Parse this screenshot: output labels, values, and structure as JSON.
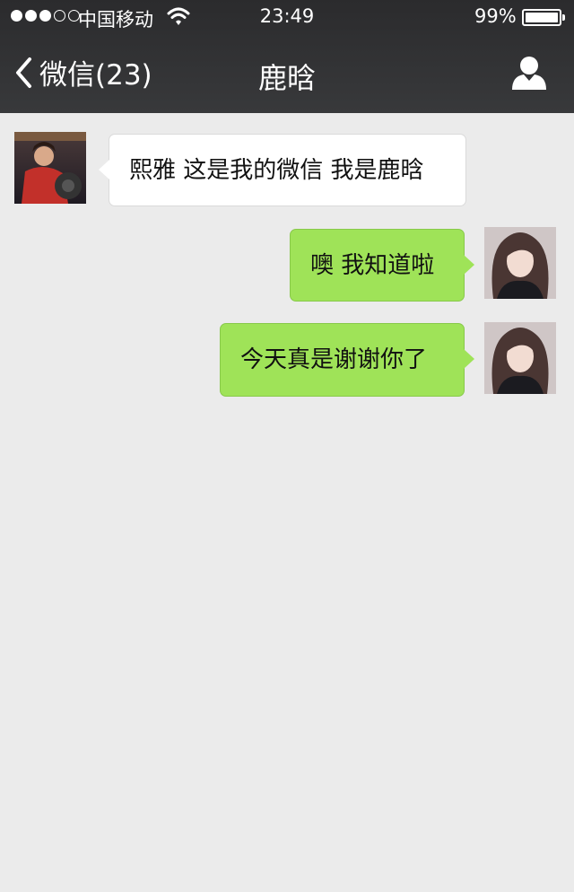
{
  "status_bar": {
    "carrier": "中国移动",
    "time": "23:49",
    "battery": "99%",
    "signal_bars_filled": 3,
    "signal_bars_total": 5
  },
  "nav": {
    "back_label": "微信(23)",
    "title": "鹿晗",
    "icons": {
      "back": "chevron-left-icon",
      "contact": "person-icon"
    }
  },
  "messages": [
    {
      "direction": "incoming",
      "text": "熙雅 这是我的微信 我是鹿晗"
    },
    {
      "direction": "outgoing",
      "text": "噢 我知道啦"
    },
    {
      "direction": "outgoing",
      "text": "今天真是谢谢你了"
    }
  ],
  "colors": {
    "navbar": "#2e2f31",
    "background": "#ebebeb",
    "outgoing_bubble": "#9fe358",
    "incoming_bubble": "#ffffff"
  }
}
